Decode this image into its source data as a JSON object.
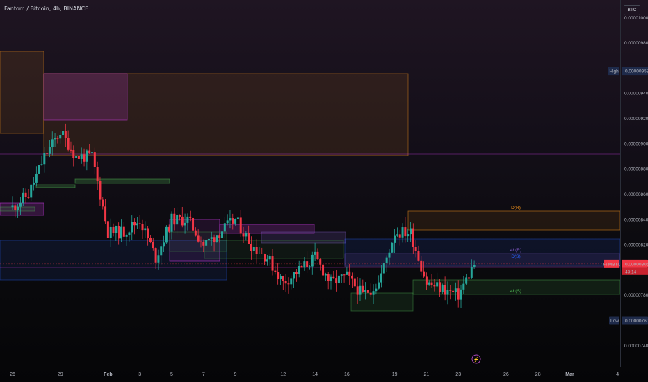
{
  "header": {
    "title": "Fantom / Bitcoin, 4h, BINANCE"
  },
  "scale": {
    "currency": "BTC"
  },
  "colors": {
    "bull": "#26a69a",
    "bear": "#f23645",
    "daily": "#f7931a",
    "weekly": "#e040fb",
    "h4": "#b2dfdb",
    "blue": "#2962ff",
    "green": "#4caf50",
    "purple": "#7e57c2"
  },
  "chart_data": {
    "type": "candlestick",
    "symbol": "FTMBTC",
    "interval": "4h",
    "exchange": "BINANCE",
    "y_axis": {
      "ticks": [
        "0.00001000",
        "0.00000980",
        "0.00000960",
        "0.00000940",
        "0.00000920",
        "0.00000900",
        "0.00000880",
        "0.00000860",
        "0.00000840",
        "0.00000820",
        "0.00000800",
        "0.00000780",
        "0.00000760",
        "0.00000740"
      ],
      "ylim": [
        7.3e-06,
        1.001e-05
      ]
    },
    "x_axis": {
      "labels": [
        "26",
        "29",
        "Feb",
        "3",
        "5",
        "7",
        "9",
        "12",
        "14",
        "16",
        "19",
        "21",
        "23",
        "26",
        "28",
        "Mar",
        "4"
      ]
    },
    "price_tags": {
      "high": {
        "label": "High",
        "value": "0.00000958"
      },
      "current": {
        "label": "FTMBTC",
        "value": "0.00000805",
        "countdown": "43:14"
      },
      "low": {
        "label": "Low",
        "value": "0.00000760"
      }
    },
    "level_labels": [
      "D(R)",
      "4h(R)",
      "D(S)",
      "4h(S)"
    ],
    "event_marker": "⚡",
    "price_anchors": [
      {
        "date": "Jan 26",
        "price": 8.5e-06
      },
      {
        "date": "Jan 27",
        "price": 8.6e-06
      },
      {
        "date": "Jan 28",
        "price": 8.9e-06
      },
      {
        "date": "Jan 29",
        "price": 9.1e-06
      },
      {
        "date": "Jan 30",
        "price": 8.9e-06
      },
      {
        "date": "Jan 31",
        "price": 8.9e-06
      },
      {
        "date": "Feb 1",
        "price": 8.3e-06
      },
      {
        "date": "Feb 2",
        "price": 8.3e-06
      },
      {
        "date": "Feb 3",
        "price": 8.4e-06
      },
      {
        "date": "Feb 4",
        "price": 8.1e-06
      },
      {
        "date": "Feb 5",
        "price": 8.4e-06
      },
      {
        "date": "Feb 6",
        "price": 8.4e-06
      },
      {
        "date": "Feb 7",
        "price": 8.2e-06
      },
      {
        "date": "Feb 8",
        "price": 8.3e-06
      },
      {
        "date": "Feb 9",
        "price": 8.4e-06
      },
      {
        "date": "Feb 10",
        "price": 8.2e-06
      },
      {
        "date": "Feb 11",
        "price": 8.1e-06
      },
      {
        "date": "Feb 12",
        "price": 7.9e-06
      },
      {
        "date": "Feb 13",
        "price": 8e-06
      },
      {
        "date": "Feb 14",
        "price": 8.1e-06
      },
      {
        "date": "Feb 15",
        "price": 7.9e-06
      },
      {
        "date": "Feb 16",
        "price": 7.95e-06
      },
      {
        "date": "Feb 17",
        "price": 7.8e-06
      },
      {
        "date": "Feb 18",
        "price": 7.9e-06
      },
      {
        "date": "Feb 19",
        "price": 8.3e-06
      },
      {
        "date": "Feb 20",
        "price": 8.3e-06
      },
      {
        "date": "Feb 21",
        "price": 7.9e-06
      },
      {
        "date": "Feb 22",
        "price": 7.85e-06
      },
      {
        "date": "Feb 23",
        "price": 7.8e-06
      },
      {
        "date": "Feb 24",
        "price": 8.05e-06
      }
    ]
  }
}
